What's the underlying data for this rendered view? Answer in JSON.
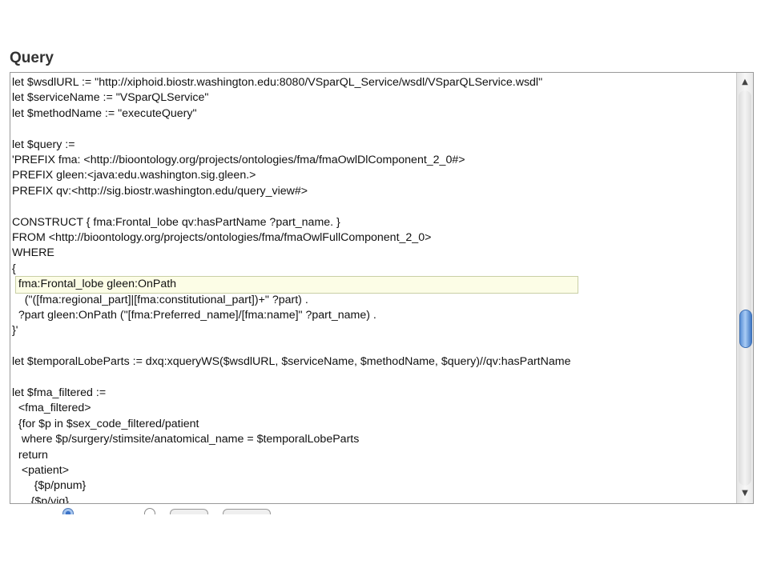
{
  "heading": "Query",
  "code_lines": [
    "let $wsdlURL := \"http://xiphoid.biostr.washington.edu:8080/VSparQL_Service/wsdl/VSparQLService.wsdl\"",
    "let $serviceName := \"VSparQLService\"",
    "let $methodName := \"executeQuery\"",
    "",
    "let $query :=",
    "'PREFIX fma: <http://bioontology.org/projects/ontologies/fma/fmaOwlDlComponent_2_0#>",
    "PREFIX gleen:<java:edu.washington.sig.gleen.>",
    "PREFIX qv:<http://sig.biostr.washington.edu/query_view#>",
    "",
    "CONSTRUCT { fma:Frontal_lobe qv:hasPartName ?part_name. }",
    "FROM <http://bioontology.org/projects/ontologies/fma/fmaOwlFullComponent_2_0>",
    "WHERE",
    "{",
    "  fma:Frontal_lobe gleen:OnPath",
    "    (\"([fma:regional_part]|[fma:constitutional_part])+\" ?part) .",
    "  ?part gleen:OnPath (\"[fma:Preferred_name]/[fma:name]\" ?part_name) .",
    "}'",
    "",
    "let $temporalLobeParts := dxq:xqueryWS($wsdlURL, $serviceName, $methodName, $query)//qv:hasPartName",
    "",
    "let $fma_filtered :=",
    "  <fma_filtered>",
    "  {for $p in $sex_code_filtered/patient",
    "   where $p/surgery/stimsite/anatomical_name = $temporalLobeParts",
    "  return",
    "   <patient>",
    "       {$p/pnum}",
    "      {$p/viq}"
  ],
  "scrollbar": {
    "up_arrow_icon": "triangle-up",
    "down_arrow_icon": "triangle-down",
    "scroll_position": 0.5
  },
  "colors": {
    "highlight_fill": "#fcfde6",
    "scroll_thumb": "#5a8fd6"
  }
}
